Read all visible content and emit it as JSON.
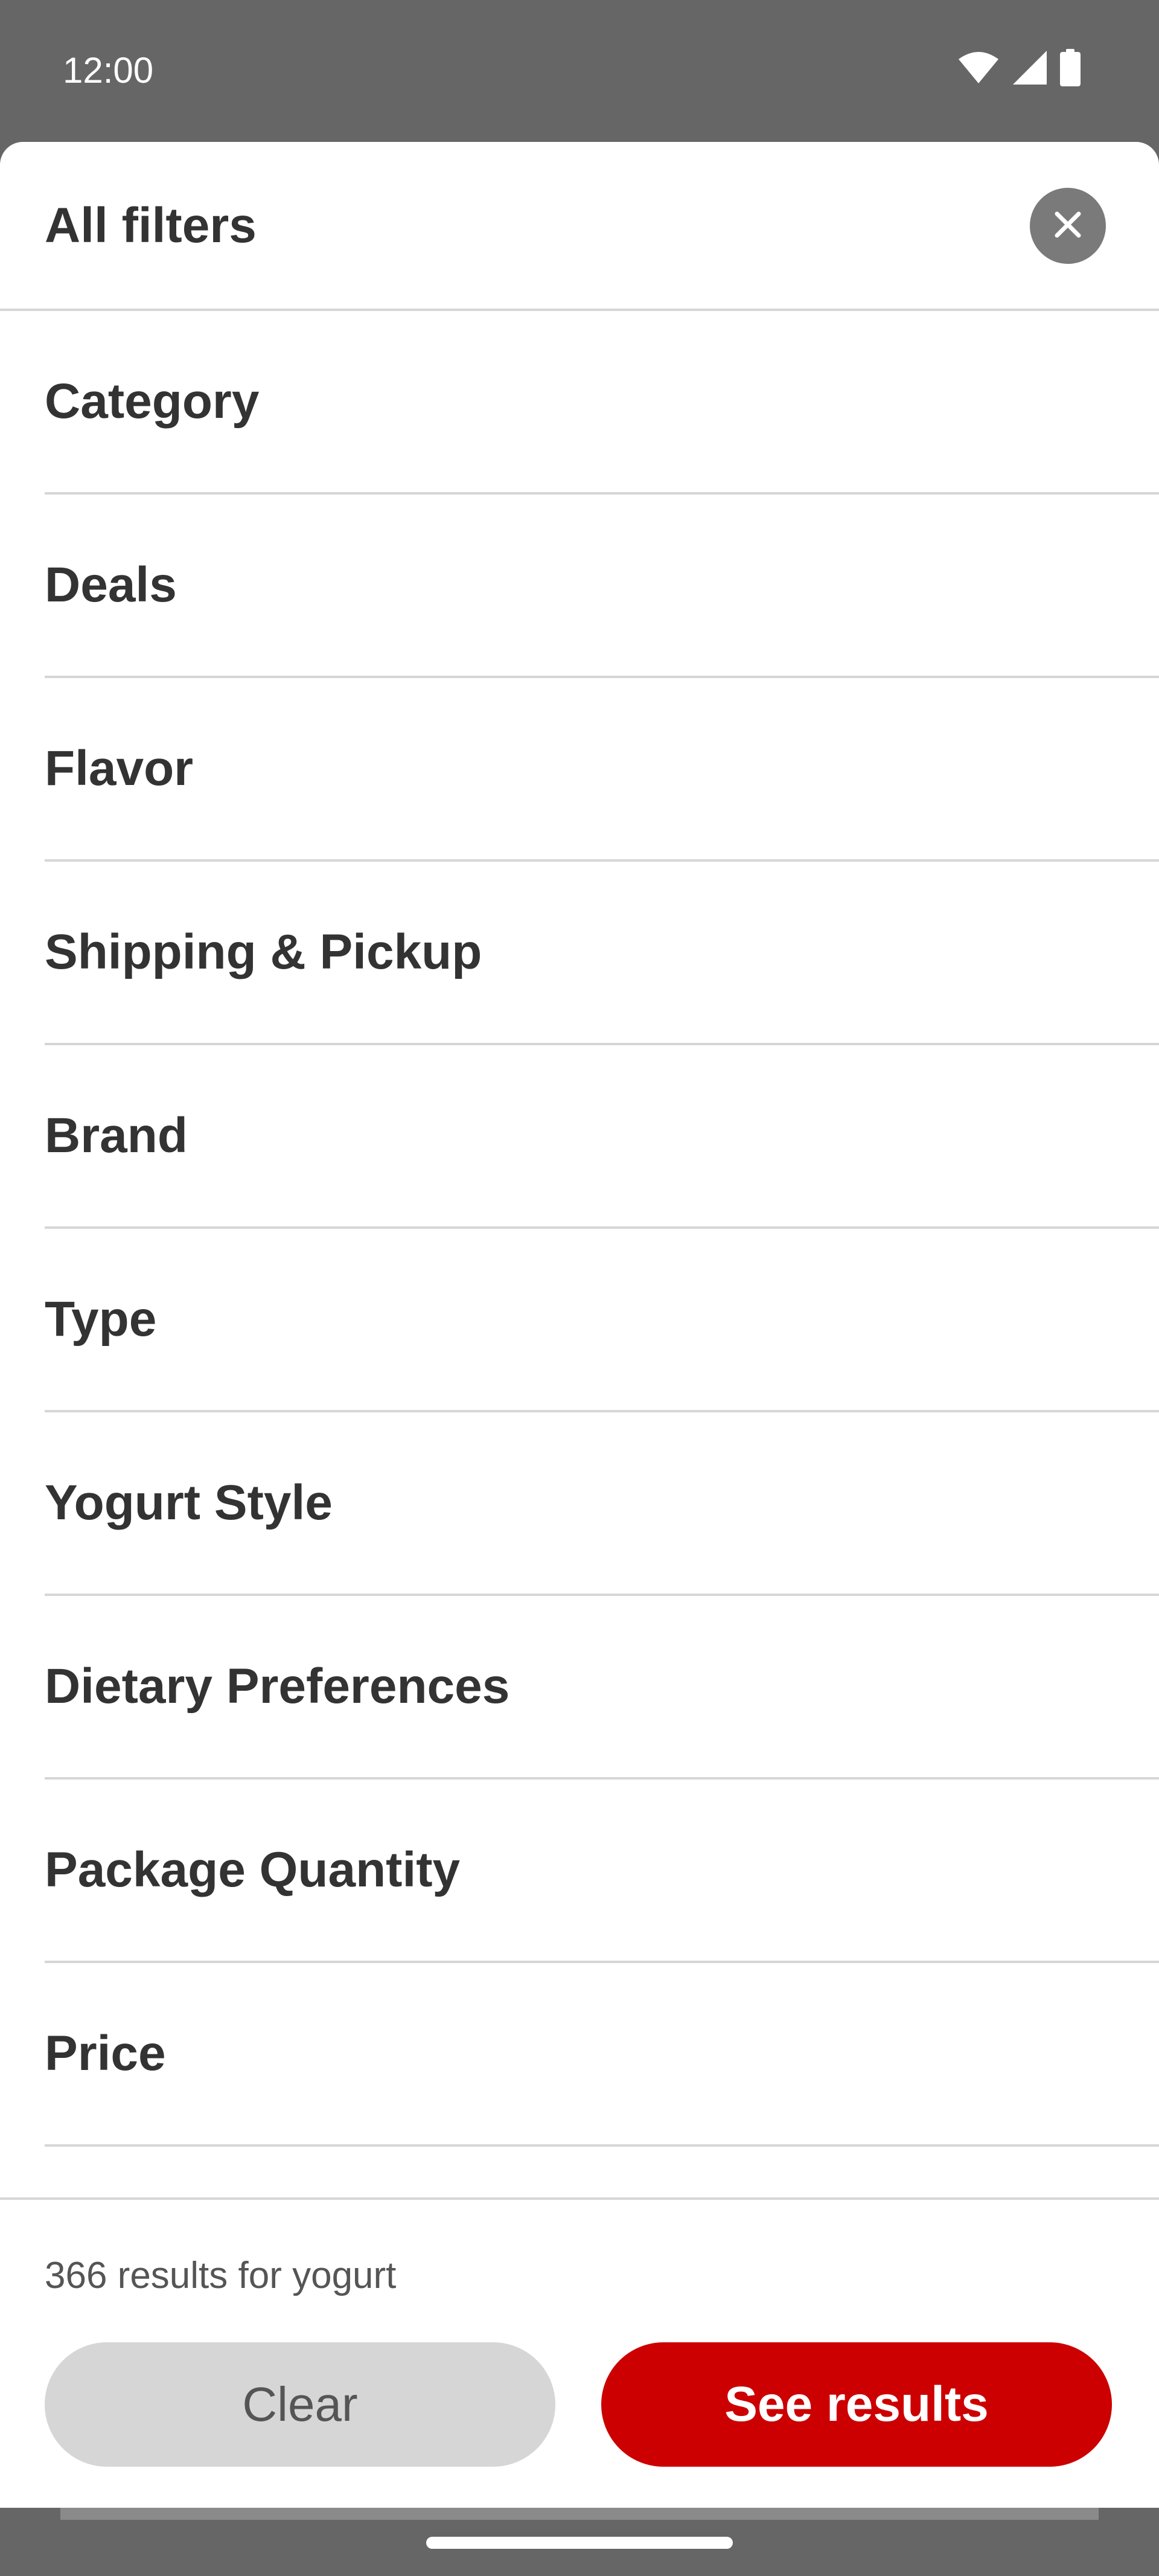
{
  "status_bar": {
    "time": "12:00",
    "icons": [
      "wifi-icon",
      "cellular-signal-icon",
      "battery-icon"
    ]
  },
  "sheet": {
    "title": "All filters",
    "close_icon": "close-icon",
    "filters": [
      {
        "label": "Category"
      },
      {
        "label": "Deals"
      },
      {
        "label": "Flavor"
      },
      {
        "label": "Shipping & Pickup"
      },
      {
        "label": "Brand"
      },
      {
        "label": "Type"
      },
      {
        "label": "Yogurt Style"
      },
      {
        "label": "Dietary Preferences"
      },
      {
        "label": "Package Quantity"
      },
      {
        "label": "Price"
      }
    ]
  },
  "footer": {
    "results_text": "366 results for yogurt",
    "clear_label": "Clear",
    "see_results_label": "See results"
  },
  "colors": {
    "accent": "#cc0000",
    "scrim": "#666666",
    "divider": "#d6d6d6",
    "text": "#333333"
  }
}
